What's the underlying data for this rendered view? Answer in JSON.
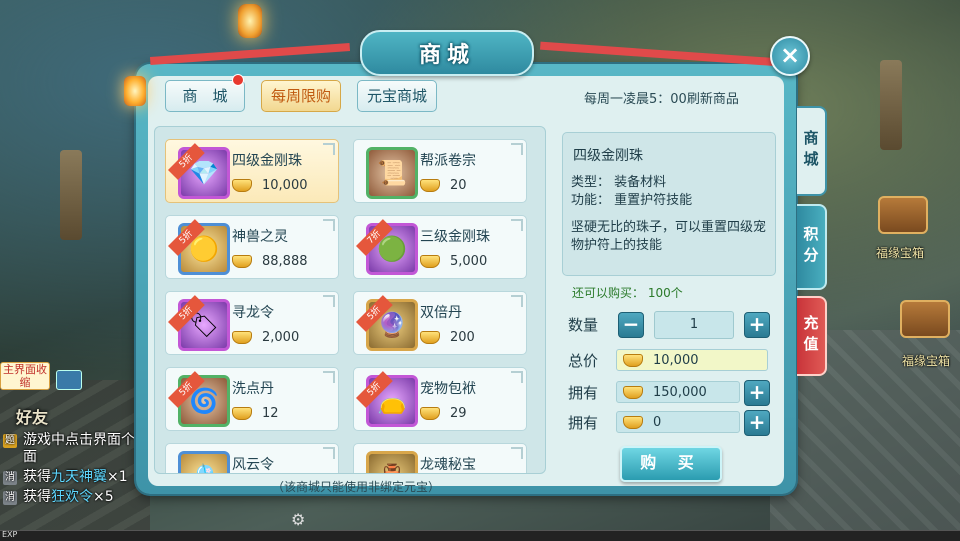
{
  "window": {
    "title": "商城",
    "close_icon": "×"
  },
  "tabs": [
    {
      "label": "商　城",
      "active": false,
      "has_notification": true
    },
    {
      "label": "每周限购",
      "active": true,
      "has_notification": false
    },
    {
      "label": "元宝商城",
      "active": false,
      "has_notification": false
    }
  ],
  "refresh_note": "每周一凌晨5：00刷新商品",
  "side_tabs": [
    "商城",
    "积分",
    "充值"
  ],
  "items": [
    {
      "discount": "5折",
      "name": "四级金刚珠",
      "price": "10,000",
      "frame": "purple",
      "icon": "purple-gem-icon",
      "selected": true
    },
    {
      "discount": "",
      "name": "帮派卷宗",
      "price": "20",
      "frame": "green",
      "icon": "scroll-icon",
      "selected": false
    },
    {
      "discount": "5折",
      "name": "神兽之灵",
      "price": "88,888",
      "frame": "blue",
      "icon": "beast-spirit-icon",
      "selected": false
    },
    {
      "discount": "7折",
      "name": "三级金刚珠",
      "price": "5,000",
      "frame": "purple",
      "icon": "green-gem-icon",
      "selected": false
    },
    {
      "discount": "5折",
      "name": "寻龙令",
      "price": "2,000",
      "frame": "purple",
      "icon": "dragon-token-icon",
      "selected": false
    },
    {
      "discount": "5折",
      "name": "双倍丹",
      "price": "200",
      "frame": "gold",
      "icon": "orb-icon",
      "selected": false
    },
    {
      "discount": "5折",
      "name": "洗点丹",
      "price": "12",
      "frame": "green",
      "icon": "pill-icon",
      "selected": false
    },
    {
      "discount": "5折",
      "name": "宠物包袱",
      "price": "29",
      "frame": "purple",
      "icon": "pouch-icon",
      "selected": false
    },
    {
      "discount": "",
      "name": "风云令",
      "price": "",
      "frame": "blue",
      "icon": "wind-token-icon",
      "selected": false
    },
    {
      "discount": "",
      "name": "龙魂秘宝",
      "price": "",
      "frame": "gold",
      "icon": "treasure-icon",
      "selected": false
    }
  ],
  "list_footer": "（该商城只能使用非绑定元宝）",
  "detail": {
    "name": "四级金刚珠",
    "type": "类型：  装备材料",
    "function": "功能：  重置护符技能",
    "description": "坚硬无比的珠子，可以重置四级宠物护符上的技能",
    "can_buy": "还可以购买：  100个"
  },
  "purchase": {
    "qty_label": "数量",
    "qty_value": "1",
    "total_label": "总价",
    "total_value": "10,000",
    "own1_label": "拥有",
    "own1_value": "150,000",
    "own2_label": "拥有",
    "own2_value": "0",
    "buy_label": "购 买"
  },
  "hud": {
    "friend_label": "好友",
    "shrink_label": "主界面收缩",
    "chat": [
      {
        "tag": "题",
        "text": "游戏中点击界面个界面",
        "highlight": ""
      },
      {
        "tag": "消",
        "text": "获得",
        "highlight": "九天神翼",
        "suffix": "×1"
      },
      {
        "tag": "消",
        "text": "获得",
        "highlight": "狂欢令",
        "suffix": "×5"
      }
    ],
    "exp_label": "EXP"
  },
  "background": {
    "chest_label_1": "福缘宝箱",
    "chest_label_2": "福缘宝箱"
  }
}
